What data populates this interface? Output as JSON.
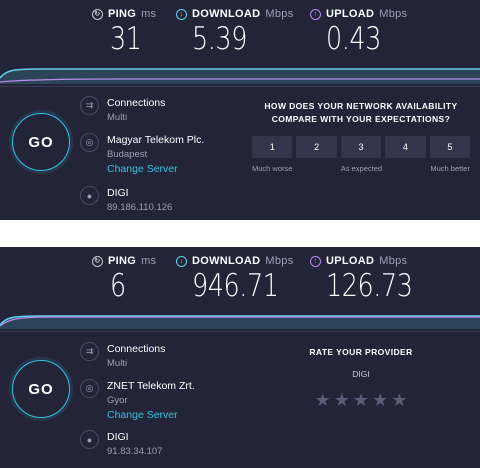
{
  "panels": [
    {
      "ping": {
        "label": "PING",
        "unit": "ms",
        "value": "31"
      },
      "download": {
        "label": "DOWNLOAD",
        "unit": "Mbps",
        "value": "5.39"
      },
      "upload": {
        "label": "UPLOAD",
        "unit": "Mbps",
        "value": "0.43"
      },
      "go_label": "GO",
      "connections": {
        "title": "Connections",
        "value": "Multi"
      },
      "server": {
        "name": "Magyar Telekom Plc.",
        "location": "Budapest",
        "change_label": "Change Server"
      },
      "isp": {
        "name": "DIGI",
        "ip": "89.186.110.126"
      },
      "survey": {
        "question_line1": "HOW DOES YOUR NETWORK AVAILABILITY",
        "question_line2": "COMPARE WITH YOUR EXPECTATIONS?",
        "options": [
          "1",
          "2",
          "3",
          "4",
          "5"
        ],
        "scale_low": "Much worse",
        "scale_mid": "As expected",
        "scale_high": "Much better"
      }
    },
    {
      "ping": {
        "label": "PING",
        "unit": "ms",
        "value": "6"
      },
      "download": {
        "label": "DOWNLOAD",
        "unit": "Mbps",
        "value": "946.71"
      },
      "upload": {
        "label": "UPLOAD",
        "unit": "Mbps",
        "value": "126.73"
      },
      "go_label": "GO",
      "connections": {
        "title": "Connections",
        "value": "Multi"
      },
      "server": {
        "name": "ZNET Telekom Zrt.",
        "location": "Gyor",
        "change_label": "Change Server"
      },
      "isp": {
        "name": "DIGI",
        "ip": "91.83.34.107"
      },
      "rate": {
        "title": "RATE YOUR PROVIDER",
        "provider": "DIGI",
        "stars": 5
      }
    }
  ],
  "colors": {
    "background": "#232438",
    "download_accent": "#5fd0e8",
    "upload_accent": "#b58cf0",
    "link": "#33c5e0",
    "muted": "#9ea0b8"
  },
  "icons": {
    "ping": "ping-icon",
    "download": "download-arrow-icon",
    "upload": "upload-arrow-icon",
    "connections": "connections-icon",
    "server": "globe-icon",
    "isp": "person-icon",
    "star": "star-icon"
  }
}
